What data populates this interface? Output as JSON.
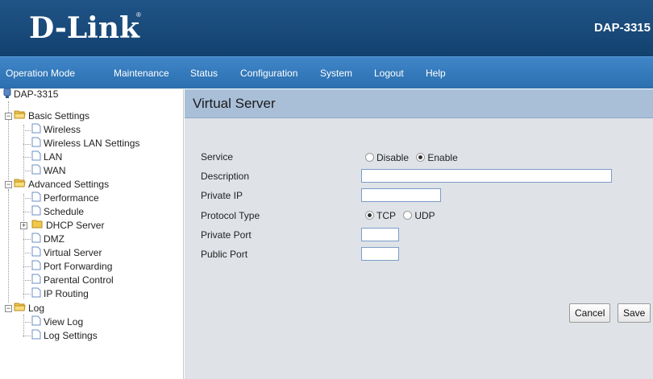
{
  "header": {
    "logo": "D-Link",
    "logo_mark": "®",
    "model": "DAP-3315"
  },
  "nav": {
    "items": [
      "Operation Mode",
      "Maintenance",
      "Status",
      "Configuration",
      "System",
      "Logout",
      "Help"
    ]
  },
  "tree": {
    "root": "DAP-3315",
    "basic_settings": "Basic Settings",
    "wireless": "Wireless",
    "wireless_lan_settings": "Wireless LAN Settings",
    "lan": "LAN",
    "wan": "WAN",
    "advanced_settings": "Advanced Settings",
    "performance": "Performance",
    "schedule": "Schedule",
    "dhcp_server": "DHCP Server",
    "dmz": "DMZ",
    "virtual_server": "Virtual Server",
    "port_forwarding": "Port Forwarding",
    "parental_control": "Parental Control",
    "ip_routing": "IP Routing",
    "log": "Log",
    "view_log": "View Log",
    "log_settings": "Log Settings"
  },
  "panel": {
    "title": "Virtual Server",
    "service_label": "Service",
    "service_disable": "Disable",
    "service_enable": "Enable",
    "service_selected": "Enable",
    "description_label": "Description",
    "description_value": "",
    "private_ip_label": "Private IP",
    "private_ip_value": "",
    "protocol_label": "Protocol Type",
    "protocol_tcp": "TCP",
    "protocol_udp": "UDP",
    "protocol_selected": "TCP",
    "private_port_label": "Private Port",
    "private_port_value": "",
    "public_port_label": "Public Port",
    "public_port_value": "",
    "cancel_label": "Cancel",
    "save_label": "Save"
  }
}
